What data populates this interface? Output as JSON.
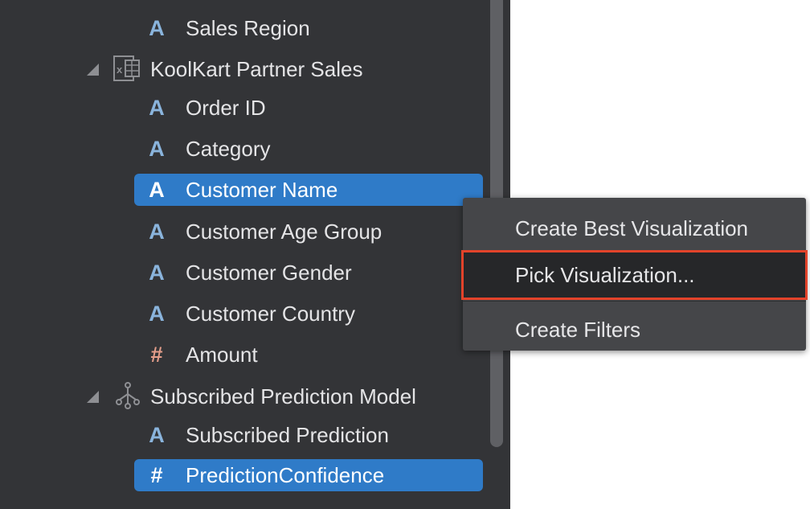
{
  "tree": {
    "fields_top": [
      {
        "label": "Sales Region",
        "type": "text"
      }
    ],
    "groups": [
      {
        "label": "KoolKart Partner Sales",
        "icon": "excel-file-icon",
        "expanded": true,
        "fields": [
          {
            "label": "Order ID",
            "type": "text"
          },
          {
            "label": "Category",
            "type": "text"
          },
          {
            "label": "Customer Name",
            "type": "text",
            "selected": true
          },
          {
            "label": "Customer Age Group",
            "type": "text"
          },
          {
            "label": "Customer Gender",
            "type": "text"
          },
          {
            "label": "Customer Country",
            "type": "text"
          },
          {
            "label": "Amount",
            "type": "number"
          }
        ]
      },
      {
        "label": "Subscribed Prediction Model",
        "icon": "model-icon",
        "expanded": true,
        "fields": [
          {
            "label": "Subscribed Prediction",
            "type": "text"
          },
          {
            "label": "PredictionConfidence",
            "type": "number",
            "selected": true
          }
        ]
      }
    ],
    "text_icon_glyph": "A",
    "number_icon_glyph": "#"
  },
  "context_menu": {
    "items": [
      {
        "label": "Create Best Visualization"
      },
      {
        "label": "Pick Visualization...",
        "highlighted": true
      },
      {
        "label": "Create Filters"
      }
    ]
  },
  "colors": {
    "panel_bg": "#333437",
    "selection": "#2f7bc8",
    "text_icon": "#8ab4dc",
    "number_icon": "#e39d8a",
    "highlight_outline": "#e2432a"
  }
}
